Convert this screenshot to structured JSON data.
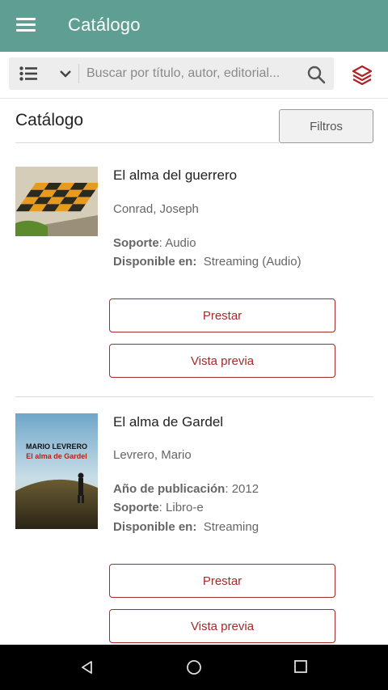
{
  "appbar": {
    "title": "Catálogo"
  },
  "search": {
    "placeholder": "Buscar por título, autor, editorial..."
  },
  "page": {
    "heading": "Catálogo",
    "filter_label": "Filtros"
  },
  "items": [
    {
      "title": "El alma del guerrero",
      "author": "Conrad, Joseph",
      "meta": [
        {
          "label": "Soporte",
          "sep": ": ",
          "value": "Audio"
        },
        {
          "label": "Disponible en:",
          "sep": "  ",
          "value": "Streaming (Audio)"
        }
      ],
      "borrow_label": "Prestar",
      "preview_label": "Vista previa"
    },
    {
      "title": "El alma de Gardel",
      "author": "Levrero, Mario",
      "cover_text": {
        "line1": "MARIO LEVRERO",
        "line2": "El alma de Gardel"
      },
      "meta": [
        {
          "label": "Año de publicación",
          "sep": ": ",
          "value": "2012"
        },
        {
          "label": "Soporte",
          "sep": ": ",
          "value": "Libro-e"
        },
        {
          "label": "Disponible en:",
          "sep": "  ",
          "value": "Streaming"
        }
      ],
      "borrow_label": "Prestar",
      "preview_label": "Vista previa"
    }
  ],
  "colors": {
    "appbar": "#5e9e93",
    "accent": "#a52a2a",
    "navbar": "#000000"
  },
  "icons": [
    "menu-icon",
    "list-view-icon",
    "chevron-down-icon",
    "search-icon",
    "layers-icon",
    "nav-back-icon",
    "nav-home-icon",
    "nav-recents-icon"
  ]
}
